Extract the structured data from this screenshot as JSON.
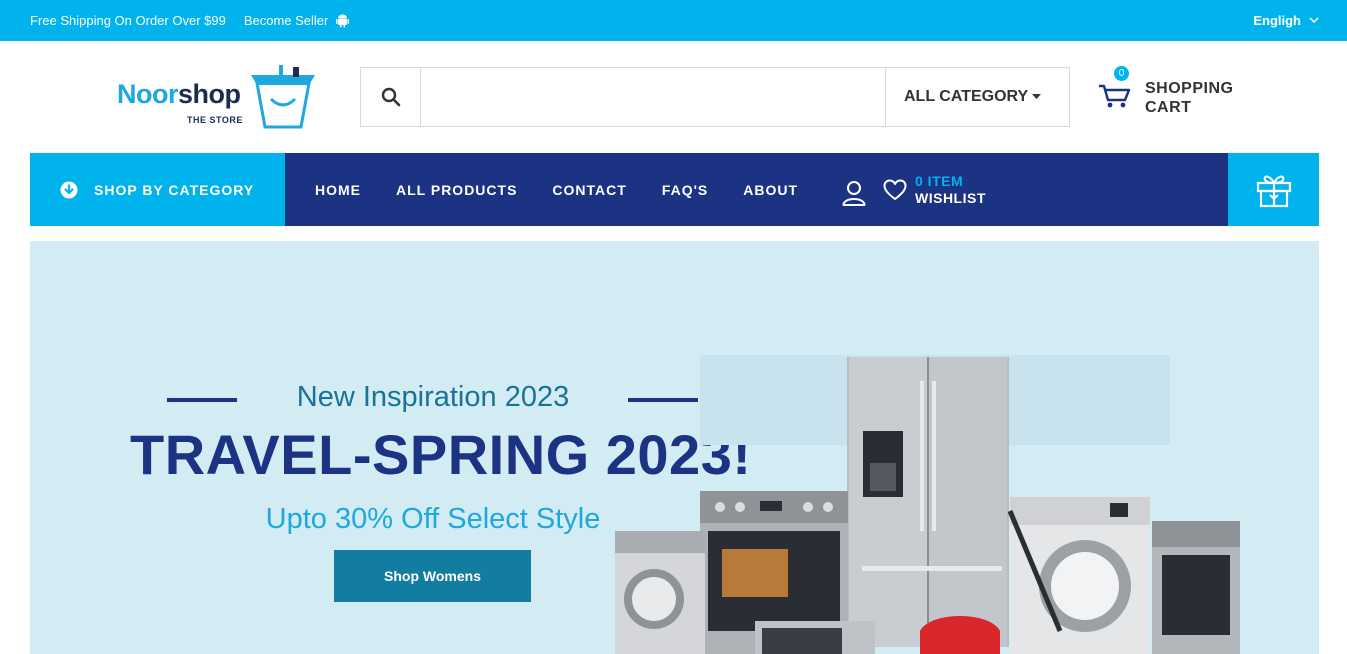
{
  "topbar": {
    "shipping": "Free Shipping On Order Over $99",
    "seller": "Become Seller",
    "language": "Engligh"
  },
  "header": {
    "logo": {
      "part1": "Noor",
      "part2": "shop",
      "tagline": "THE STORE"
    },
    "search": {
      "placeholder": "",
      "category": "ALL CATEGORY"
    },
    "cart": {
      "count": "0",
      "label": "SHOPPING CART"
    }
  },
  "nav": {
    "shop_by_category": "SHOP BY CATEGORY",
    "items": [
      "HOME",
      "ALL PRODUCTS",
      "CONTACT",
      "FAQ'S",
      "ABOUT"
    ],
    "wishlist": {
      "count": "0 ITEM",
      "label": "WISHLIST"
    }
  },
  "hero": {
    "subtitle": "New Inspiration 2023",
    "title": "TRAVEL-SPRING 2023!",
    "offer": "Upto 30% Off Select Style",
    "cta": "Shop Womens"
  },
  "colors": {
    "accent": "#00b3ec",
    "navy": "#1c3283",
    "hero_bg": "#d3ebf3",
    "cta": "#127da0"
  },
  "icons": [
    "android-icon",
    "chevron-down-icon",
    "search-icon",
    "caret-down-icon",
    "cart-icon",
    "arrow-circle-down-icon",
    "user-icon",
    "heart-icon",
    "gift-icon"
  ]
}
